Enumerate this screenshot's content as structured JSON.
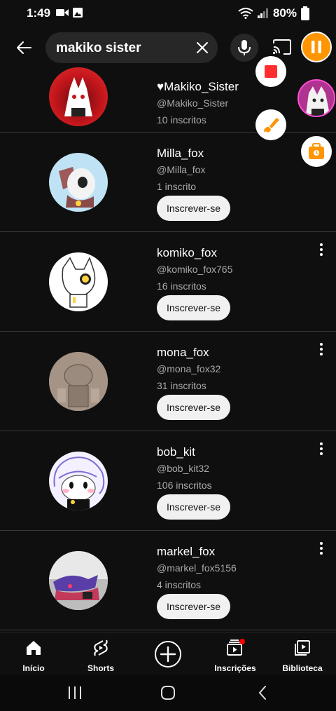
{
  "status_bar": {
    "time": "1:49",
    "battery": "80%"
  },
  "search": {
    "query": "makiko sister"
  },
  "channels": [
    {
      "name": "♥Makiko_Sister",
      "handle": "@Makiko_Sister",
      "subscribers": "10 inscritos",
      "avatar_color": "#c4161c"
    },
    {
      "name": "Milla_fox",
      "handle": "@Milla_fox",
      "subscribers": "1 inscrito",
      "button": "Inscrever-se",
      "avatar_color": "#bfe3f5"
    },
    {
      "name": "komiko_fox",
      "handle": "@komiko_fox765",
      "subscribers": "16 inscritos",
      "button": "Inscrever-se",
      "avatar_color": "#ffffff"
    },
    {
      "name": "mona_fox",
      "handle": "@mona_fox32",
      "subscribers": "31 inscritos",
      "button": "Inscrever-se",
      "avatar_color": "#8f7f72"
    },
    {
      "name": "bob_kit",
      "handle": "@bob_kit32",
      "subscribers": "106 inscritos",
      "button": "Inscrever-se",
      "avatar_color": "#f4f0ff"
    },
    {
      "name": "markel_fox",
      "handle": "@markel_fox5156",
      "subscribers": "4 inscritos",
      "button": "Inscrever-se",
      "avatar_color": "#d4d4d4"
    }
  ],
  "bottom_nav": {
    "home": "Início",
    "shorts": "Shorts",
    "subscriptions": "Inscrições",
    "library": "Biblioteca"
  },
  "colors": {
    "background": "#0f0f0f",
    "recorder_accent": "#ff9500",
    "stop_red": "#ff2d2d",
    "notification_dot": "#ff0000"
  }
}
